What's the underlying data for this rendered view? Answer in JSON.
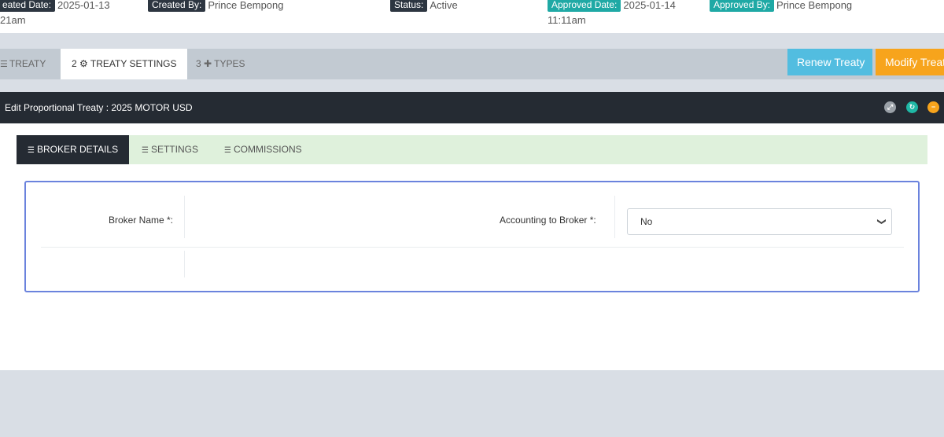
{
  "meta": {
    "created_date_label": "eated Date:",
    "created_date_value": "2025-01-13",
    "created_time": "21am",
    "created_by_label": "Created By:",
    "created_by_value": "Prince Bempong",
    "status_label": "Status:",
    "status_value": "Active",
    "approved_date_label": "Approved Date:",
    "approved_date_value": "2025-01-14",
    "approved_time": "11:11am",
    "approved_by_label": "Approved By:",
    "approved_by_value": "Prince Bempong"
  },
  "steps": [
    {
      "label": "TREATY",
      "icon": "list-icon"
    },
    {
      "label": "2 ⚙ TREATY SETTINGS",
      "icon": "gear-icon"
    },
    {
      "label": "3 ✚ TYPES",
      "icon": "plus-icon"
    }
  ],
  "actions": {
    "renew_label": "Renew Treaty",
    "modify_label": "Modify Treaty"
  },
  "panel": {
    "title": "Edit Proportional Treaty : 2025 MOTOR USD",
    "header_icons": [
      "expand-icon",
      "reload-icon",
      "collapse-icon"
    ]
  },
  "sub_tabs": [
    {
      "label": "BROKER DETAILS",
      "active": true
    },
    {
      "label": "SETTINGS",
      "active": false
    },
    {
      "label": "COMMISSIONS",
      "active": false
    }
  ],
  "form": {
    "broker_name_label": "Broker Name *:",
    "accounting_label": "Accounting to Broker *:",
    "accounting_value": "No"
  },
  "colors": {
    "accent_teal": "#1fa9a5",
    "renew_blue": "#52bde0",
    "modify_orange": "#f7a41c",
    "dark_header": "#252b33",
    "tab_green": "#dff1dc",
    "form_border": "#6b83dd"
  }
}
